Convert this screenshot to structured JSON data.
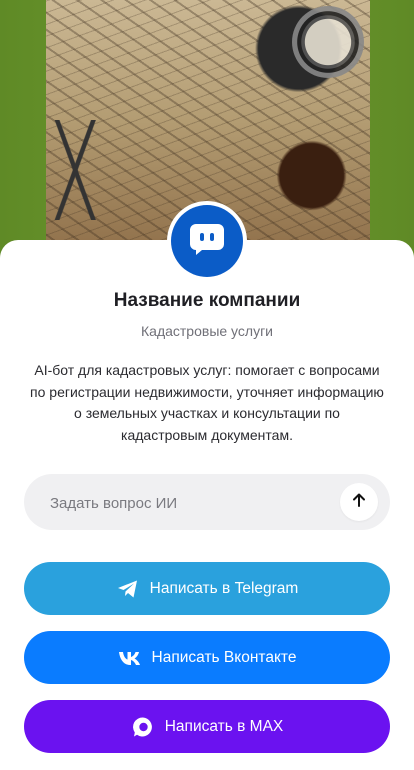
{
  "company": {
    "name": "Название компании",
    "category": "Кадастровые услуги",
    "description": "AI-бот для кадастровых услуг: помогает с вопросами по регистрации недвижимости, уточняет информацию о земельных участках и консультации по кадастровым документам."
  },
  "ask": {
    "placeholder": "Задать вопрос ИИ"
  },
  "buttons": {
    "telegram": "Написать в Telegram",
    "vk": "Написать Вконтакте",
    "max": "Написать в MAX"
  },
  "colors": {
    "avatar": "#0b5cc7",
    "telegram": "#2aa1dd",
    "vk": "#0a7cff",
    "max": "#6b12f0",
    "background": "#6b8f2a"
  }
}
